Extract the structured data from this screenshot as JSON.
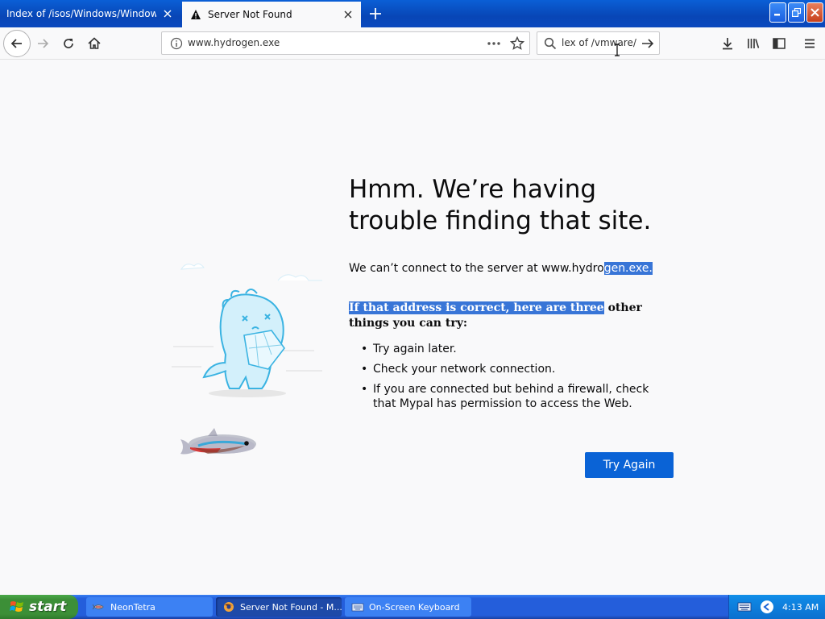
{
  "browser": {
    "tabs": [
      {
        "label": "Index of /isos/Windows/Windows_Vista",
        "active": false
      },
      {
        "label": "Server Not Found",
        "active": true
      }
    ],
    "url": "www.hydrogen.exe",
    "search_value": "lex of /vmware/"
  },
  "error_page": {
    "title": "Hmm. We’re having trouble finding that site.",
    "desc_plain": "We can’t connect to the server at www.hydro",
    "desc_selected": "gen.exe.",
    "tips_heading_selected": "If that address is correct, here are three",
    "tips_heading_rest": " other things you can try:",
    "tips": [
      "Try again later.",
      "Check your network connection.",
      "If you are connected but behind a firewall, check that Mypal has permission to access the Web."
    ],
    "button_label": "Try Again"
  },
  "taskbar": {
    "start_label": "start",
    "tasks": [
      {
        "label": "NeonTetra",
        "active": false
      },
      {
        "label": "Server Not Found - M...",
        "active": true
      },
      {
        "label": "On-Screen Keyboard",
        "active": false
      }
    ],
    "clock": "4:13 AM"
  },
  "colors": {
    "accent": "#0a63d6",
    "selection": "#3875d7",
    "titlebar": "#0a5fd6",
    "taskbar": "#245edb",
    "start": "#3c8f37"
  }
}
